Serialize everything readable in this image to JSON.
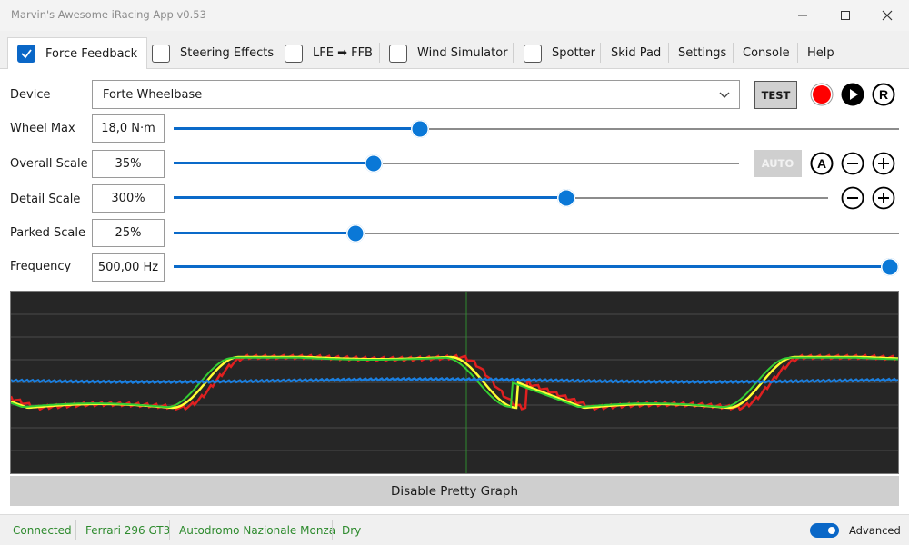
{
  "window": {
    "title": "Marvin's Awesome iRacing App v0.53",
    "minimize_icon": "minimize-icon",
    "maximize_icon": "maximize-icon",
    "close_icon": "close-icon"
  },
  "tabs": [
    {
      "label": "Force Feedback",
      "checkbox": true,
      "checked": true,
      "active": true
    },
    {
      "label": "Steering Effects",
      "checkbox": true,
      "checked": false
    },
    {
      "label": "LFE ➡ FFB",
      "checkbox": true,
      "checked": false
    },
    {
      "label": "Wind Simulator",
      "checkbox": true,
      "checked": false
    },
    {
      "label": "Spotter",
      "checkbox": true,
      "checked": false
    },
    {
      "label": "Skid Pad",
      "checkbox": false
    },
    {
      "label": "Settings",
      "checkbox": false
    },
    {
      "label": "Console",
      "checkbox": false
    },
    {
      "label": "Help",
      "checkbox": false
    }
  ],
  "ffb": {
    "device_label": "Device",
    "device_value": "Forte Wheelbase",
    "test_label": "TEST",
    "auto_label": "AUTO",
    "record_color": "#ff0000",
    "rows": [
      {
        "label": "Wheel Max",
        "value": "18,0 N·m",
        "level": 0.34
      },
      {
        "label": "Overall Scale",
        "value": "35%",
        "level": 0.354
      },
      {
        "label": "Detail Scale",
        "value": "300%",
        "level": 0.6
      },
      {
        "label": "Parked Scale",
        "value": "25%",
        "level": 0.25
      },
      {
        "label": "Frequency",
        "value": "500,00 Hz",
        "level": 1.0
      }
    ],
    "graph_button": "Disable Pretty Graph",
    "graph_colors": {
      "background": "#262626",
      "grid": "#4a4a4a",
      "cursor": "#2f8a2f",
      "red": "#e02020",
      "yellow": "#ffff33",
      "green": "#33cc33",
      "blue": "#1a7fe0"
    }
  },
  "status": {
    "connection": "Connected",
    "car": "Ferrari 296 GT3",
    "track": "Autodromo Nazionale Monza",
    "weather": "Dry",
    "advanced_label": "Advanced",
    "advanced_on": true
  }
}
